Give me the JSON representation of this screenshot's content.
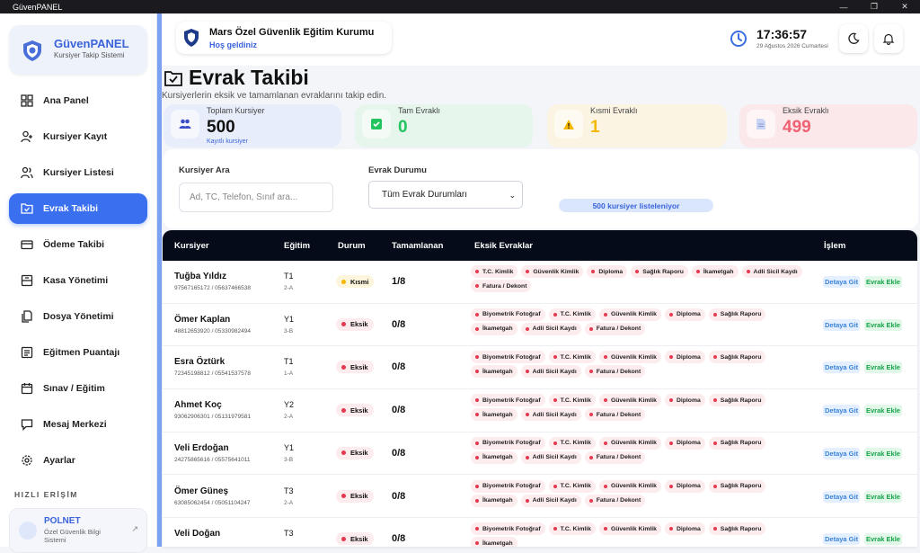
{
  "app": {
    "window_title": "GüvenPANEL"
  },
  "brand": {
    "title": "GüvenPANEL",
    "subtitle": "Kursiyer Takip Sistemi"
  },
  "sidebar": {
    "items": [
      {
        "label": "Ana Panel",
        "icon": "dashboard-icon"
      },
      {
        "label": "Kursiyer Kayıt",
        "icon": "user-plus-icon"
      },
      {
        "label": "Kursiyer Listesi",
        "icon": "users-icon"
      },
      {
        "label": "Evrak Takibi",
        "icon": "folder-check-icon",
        "active": true
      },
      {
        "label": "Ödeme Takibi",
        "icon": "credit-card-icon"
      },
      {
        "label": "Kasa Yönetimi",
        "icon": "cash-box-icon"
      },
      {
        "label": "Dosya Yönetimi",
        "icon": "files-icon"
      },
      {
        "label": "Eğitmen Puantajı",
        "icon": "timesheet-icon"
      },
      {
        "label": "Sınav / Eğitim",
        "icon": "calendar-icon"
      },
      {
        "label": "Mesaj Merkezi",
        "icon": "message-icon"
      },
      {
        "label": "Ayarlar",
        "icon": "gear-icon"
      }
    ],
    "quick_title": "HIZLI ERİŞİM",
    "polnet": {
      "title": "POLNET",
      "subtitle": "Özel Güvenlik Bilgi Sistemi"
    }
  },
  "header": {
    "org_name": "Mars Özel Güvenlik Eğitim Kurumu",
    "welcome": "Hoş geldiniz",
    "time": "17:36:57",
    "date": "29 Ağustos 2026 Cumartesi"
  },
  "page": {
    "title": "Evrak Takibi",
    "subtitle": "Kursiyerlerin eksik ve tamamlanan evraklarını takip edin."
  },
  "stats": [
    {
      "label": "Toplam Kursiyer",
      "value": "500",
      "caption": "Kayıtlı kursiyer",
      "color": "#111111",
      "bg": "#e8edfb",
      "icon": "users-icon"
    },
    {
      "label": "Tam Evraklı",
      "value": "0",
      "caption": "",
      "color": "#22c55e",
      "bg": "#e6f6ec",
      "icon": "check-square-icon"
    },
    {
      "label": "Kısmi Evraklı",
      "value": "1",
      "caption": "",
      "color": "#f5b800",
      "bg": "#fbf4e2",
      "icon": "warning-icon"
    },
    {
      "label": "Eksik Evraklı",
      "value": "499",
      "caption": "",
      "color": "#f06272",
      "bg": "#fbe8ea",
      "icon": "document-icon"
    }
  ],
  "filters": {
    "search_label": "Kursiyer Ara",
    "search_placeholder": "Ad, TC, Telefon, Sınıf ara...",
    "status_label": "Evrak Durumu",
    "status_value": "Tüm Evrak Durumları",
    "count_text": "500 kursiyer listeleniyor"
  },
  "table": {
    "headers": [
      "Kursiyer",
      "Eğitim",
      "Durum",
      "Tamamlanan",
      "Eksik Evraklar",
      "İşlem"
    ],
    "action_detail": "Detaya Git",
    "action_add": "Evrak Ekle",
    "rows": [
      {
        "name": "Tuğba Yıldız",
        "phone": "97567165172 / 05637466538",
        "egitim": "T1",
        "sinif": "2-A",
        "durum": "Kısmi",
        "tam": "1/8",
        "docs": [
          "T.C. Kimlik",
          "Güvenlik Kimlik",
          "Diploma",
          "Sağlık Raporu",
          "İkametgah",
          "Adli Sicil Kaydı",
          "Fatura / Dekont"
        ]
      },
      {
        "name": "Ömer Kaplan",
        "phone": "48812653920 / 05330982494",
        "egitim": "Y1",
        "sinif": "3-B",
        "durum": "Eksik",
        "tam": "0/8",
        "docs": [
          "Biyometrik Fotoğraf",
          "T.C. Kimlik",
          "Güvenlik Kimlik",
          "Diploma",
          "Sağlık Raporu",
          "İkametgah",
          "Adli Sicil Kaydı",
          "Fatura / Dekont"
        ]
      },
      {
        "name": "Esra Öztürk",
        "phone": "72345198812 / 05541537578",
        "egitim": "T1",
        "sinif": "1-A",
        "durum": "Eksik",
        "tam": "0/8",
        "docs": [
          "Biyometrik Fotoğraf",
          "T.C. Kimlik",
          "Güvenlik Kimlik",
          "Diploma",
          "Sağlık Raporu",
          "İkametgah",
          "Adli Sicil Kaydı",
          "Fatura / Dekont"
        ]
      },
      {
        "name": "Ahmet Koç",
        "phone": "93062906301 / 05131979581",
        "egitim": "Y2",
        "sinif": "2-A",
        "durum": "Eksik",
        "tam": "0/8",
        "docs": [
          "Biyometrik Fotoğraf",
          "T.C. Kimlik",
          "Güvenlik Kimlik",
          "Diploma",
          "Sağlık Raporu",
          "İkametgah",
          "Adli Sicil Kaydı",
          "Fatura / Dekont"
        ]
      },
      {
        "name": "Veli Erdoğan",
        "phone": "24275865616 / 05575641011",
        "egitim": "Y1",
        "sinif": "3-B",
        "durum": "Eksik",
        "tam": "0/8",
        "docs": [
          "Biyometrik Fotoğraf",
          "T.C. Kimlik",
          "Güvenlik Kimlik",
          "Diploma",
          "Sağlık Raporu",
          "İkametgah",
          "Adli Sicil Kaydı",
          "Fatura / Dekont"
        ]
      },
      {
        "name": "Ömer Güneş",
        "phone": "63085062454 / 05051104247",
        "egitim": "T3",
        "sinif": "2-A",
        "durum": "Eksik",
        "tam": "0/8",
        "docs": [
          "Biyometrik Fotoğraf",
          "T.C. Kimlik",
          "Güvenlik Kimlik",
          "Diploma",
          "Sağlık Raporu",
          "İkametgah",
          "Adli Sicil Kaydı",
          "Fatura / Dekont"
        ]
      },
      {
        "name": "Veli Doğan",
        "phone": "",
        "egitim": "T3",
        "sinif": "",
        "durum": "Eksik",
        "tam": "0/8",
        "docs": [
          "Biyometrik Fotoğraf",
          "T.C. Kimlik",
          "Güvenlik Kimlik",
          "Diploma",
          "Sağlık Raporu",
          "İkametgah"
        ]
      }
    ]
  }
}
